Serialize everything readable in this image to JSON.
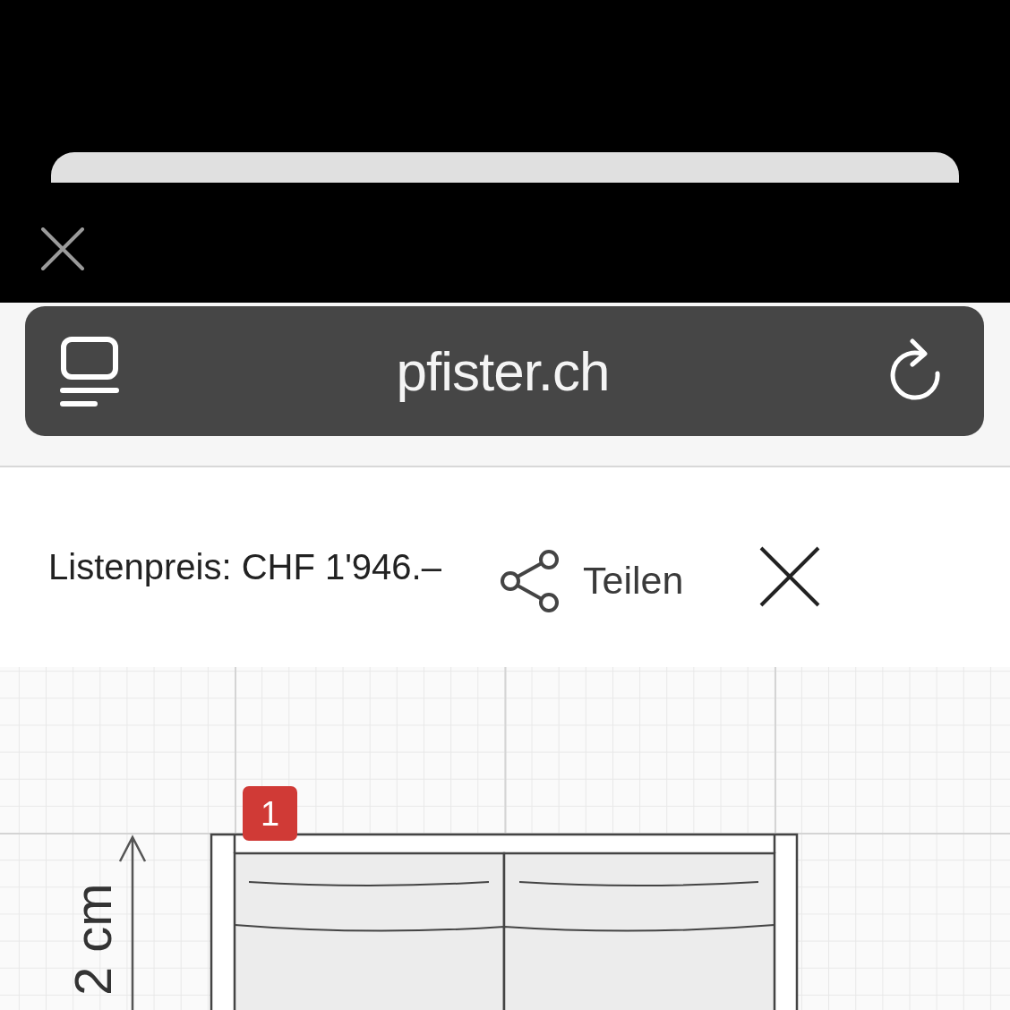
{
  "browser": {
    "url": "pfister.ch"
  },
  "product_header": {
    "price": "Listenpreis: CHF 1'946.–",
    "share_label": "Teilen"
  },
  "floor_plan": {
    "item_badge": "1",
    "dimension_label": "2 cm"
  }
}
